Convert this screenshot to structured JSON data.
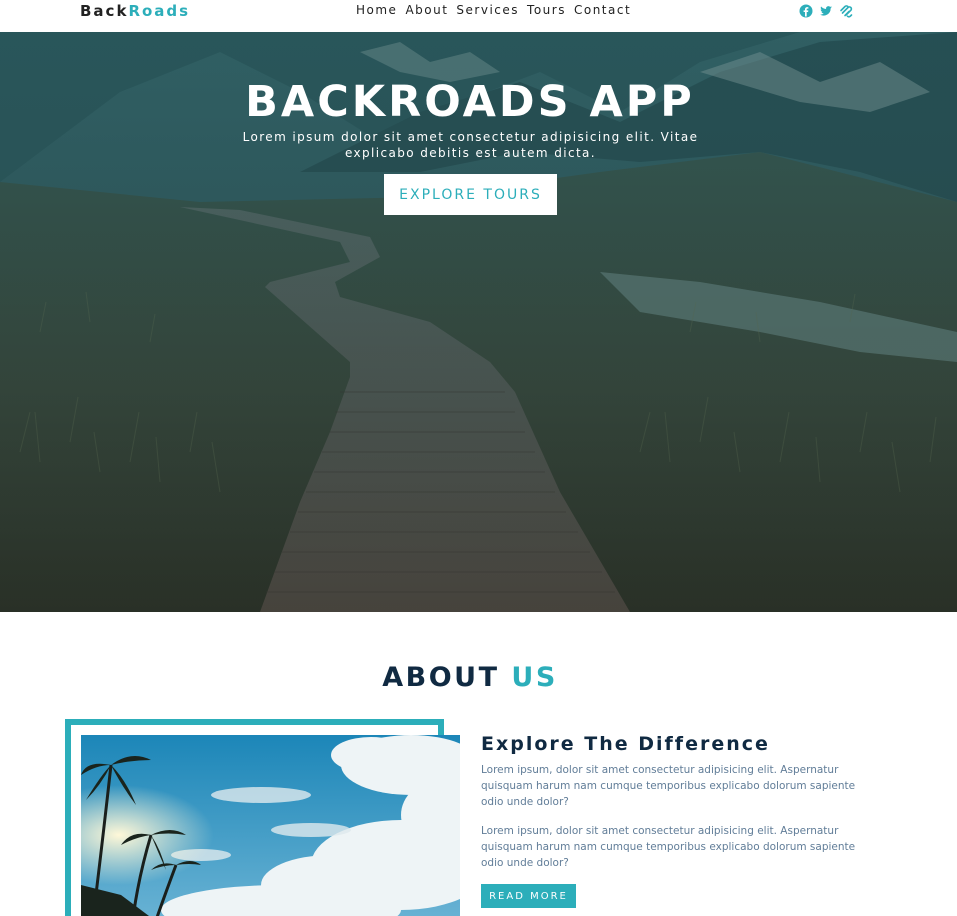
{
  "navbar": {
    "logo_part1": "Back",
    "logo_part2": "Roads",
    "links": [
      "Home",
      "About",
      "Services",
      "Tours",
      "Contact"
    ],
    "social_icons": [
      "facebook-icon",
      "twitter-icon",
      "squarespace-icon"
    ]
  },
  "hero": {
    "title": "BACKROADS APP",
    "text": "Lorem ipsum dolor sit amet consectetur adipisicing elit. Vitae explicabo debitis est autem dicta.",
    "button": "EXPLORE TOURS"
  },
  "about": {
    "title_part1": "ABOUT",
    "title_part2": "US",
    "heading": "Explore The Difference",
    "paragraph1": "Lorem ipsum, dolor sit amet consectetur adipisicing elit. Aspernatur quisquam harum nam cumque temporibus explicabo dolorum sapiente odio unde dolor?",
    "paragraph2": "Lorem ipsum, dolor sit amet consectetur adipisicing elit. Aspernatur quisquam harum nam cumque temporibus explicabo dolorum sapiente odio unde dolor?",
    "button": "READ MORE"
  },
  "colors": {
    "primary": "#2caeba",
    "heading": "#102a42",
    "body_text": "#617d98"
  }
}
